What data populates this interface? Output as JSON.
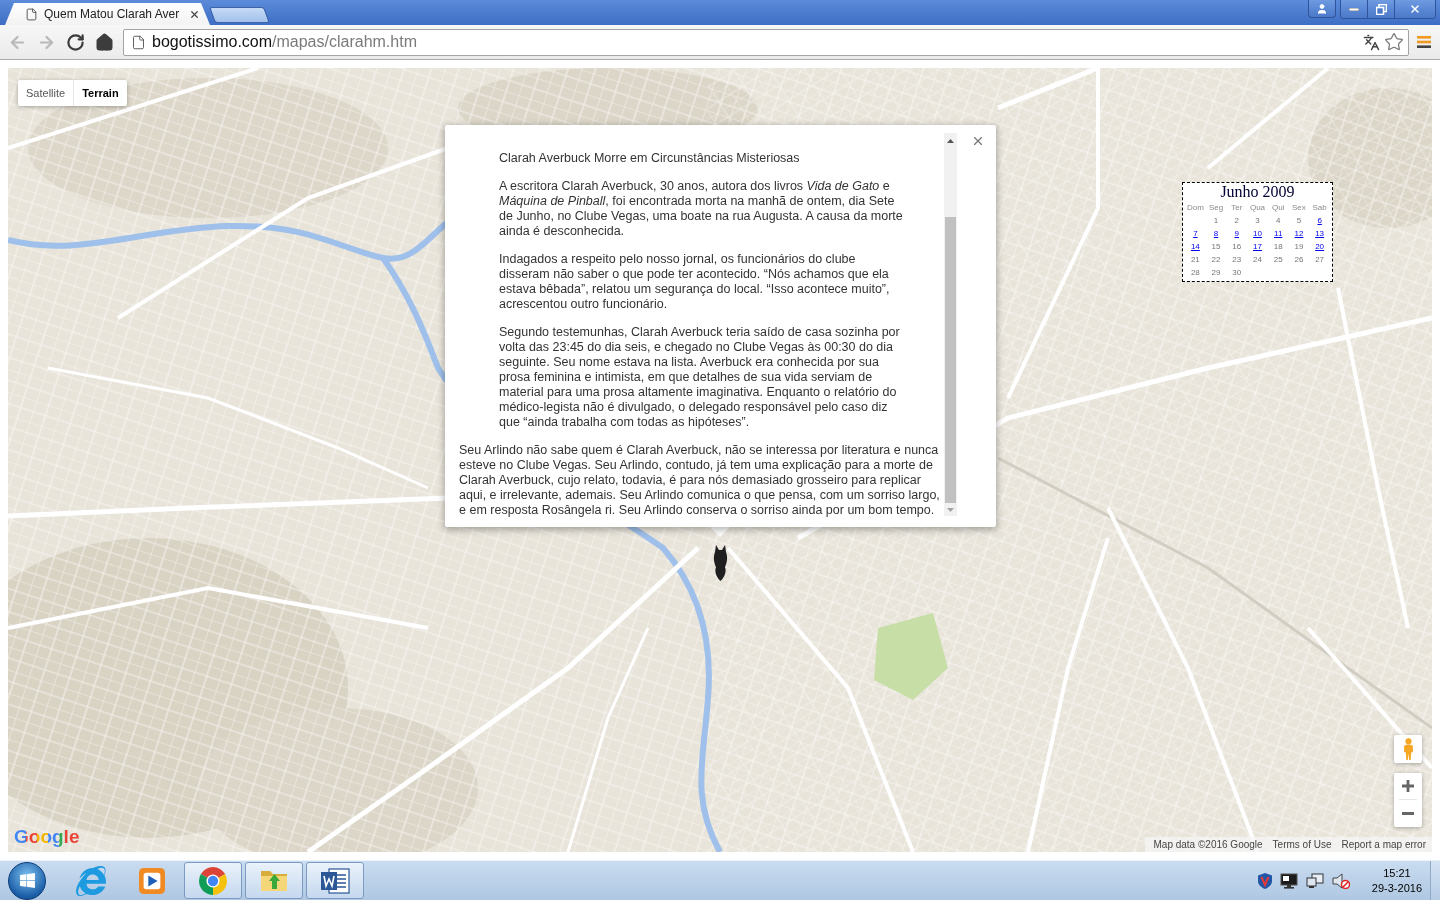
{
  "browser": {
    "tabs": [
      {
        "title": "Quem Matou Clarah Aver",
        "selected": true
      }
    ],
    "nav_buttons": [
      {
        "kind": "back",
        "disabled": true
      },
      {
        "kind": "forward",
        "disabled": true
      },
      {
        "kind": "reload",
        "disabled": false
      },
      {
        "kind": "home",
        "disabled": false
      }
    ],
    "address": {
      "host": "bogotissimo.com",
      "path": "/mapas/clarahm.htm"
    },
    "menu": {
      "update_available": true
    }
  },
  "map": {
    "map_types": [
      {
        "label": "Satellite",
        "selected": false
      },
      {
        "label": "Terrain",
        "selected": true
      }
    ],
    "info_window": {
      "quote": [
        "Clarah Averbuck Morre em Circunstâncias Misteriosas",
        "A escritora Clarah Averbuck, 30 anos, autora dos livros *Vida de Gato* e *Máquina de Pinball*, foi encontrada morta na manhã de ontem, dia Sete de Junho, no Clube Vegas, uma boate na rua Augusta. A causa da morte ainda é desconhecida.",
        "Indagados a respeito pelo nosso jornal, os funcionários do clube disseram não saber o que pode ter acontecido. “Nós achamos que ela estava bêbada”, relatou um segurança do local. “Isso acontece muito”, acrescentou outro funcionário.",
        "Segundo testemunhas, Clarah Averbuck teria saído de casa sozinha por volta das 23:45 do dia seis, e chegado no Clube Vegas às 00:30 do dia seguinte. Seu nome estava na lista. Averbuck era conhecida por sua prosa feminina e intimista, em que detalhes de sua vida serviam de material para uma prosa altamente imaginativa. Enquanto o relatório do médico-legista não é divulgado, o delegado responsável pelo caso diz que “ainda trabalha com todas as hipóteses”."
      ],
      "paragraph": "Seu Arlindo não sabe quem é Clarah Averbuck, não se interessa por literatura e nunca esteve no Clube Vegas. Seu Arlindo, contudo, já tem uma explicação para a morte de Clarah Averbuck, cujo relato, todavia, é para nós demasiado grosseiro para replicar aqui, e irrelevante, ademais. Seu Arlindo comunica o que pensa, com um sorriso largo, e em resposta Rosângela ri. Seu Arlindo conserva o sorriso ainda por um bom tempo."
    },
    "calendar": {
      "title": "Junho 2009",
      "weekdays": [
        "Dom",
        "Seg",
        "Ter",
        "Qua",
        "Qui",
        "Sex",
        "Sab"
      ],
      "weeks": [
        {
          "days": [
            {
              "label": "1",
              "linked": false
            },
            {
              "label": "2",
              "linked": false
            },
            {
              "label": "3",
              "linked": false
            },
            {
              "label": "4",
              "linked": false
            },
            {
              "label": "5",
              "linked": false
            },
            {
              "label": "6",
              "linked": true
            }
          ]
        },
        {
          "days": [
            {
              "label": "7",
              "linked": true
            },
            {
              "label": "8",
              "linked": true
            },
            {
              "label": "9",
              "linked": true
            },
            {
              "label": "10",
              "linked": true
            },
            {
              "label": "11",
              "linked": true
            },
            {
              "label": "12",
              "linked": true
            },
            {
              "label": "13",
              "linked": true
            }
          ]
        },
        {
          "days": [
            {
              "label": "14",
              "linked": true
            },
            {
              "label": "15",
              "linked": false
            },
            {
              "label": "16",
              "linked": false
            },
            {
              "label": "17",
              "linked": true
            },
            {
              "label": "18",
              "linked": false
            },
            {
              "label": "19",
              "linked": false
            },
            {
              "label": "20",
              "linked": true
            }
          ]
        },
        {
          "days": [
            {
              "label": "21",
              "linked": false
            },
            {
              "label": "22",
              "linked": false
            },
            {
              "label": "23",
              "linked": false
            },
            {
              "label": "24",
              "linked": false
            },
            {
              "label": "25",
              "linked": false
            },
            {
              "label": "26",
              "linked": false
            },
            {
              "label": "27",
              "linked": false
            }
          ]
        },
        {
          "days": [
            {
              "label": "28",
              "linked": false
            },
            {
              "label": "29",
              "linked": false
            },
            {
              "label": "30",
              "linked": false
            }
          ]
        }
      ]
    },
    "logo": "Google",
    "attribution": {
      "data": "Map data ©2016 Google",
      "links": [
        "Terms of Use",
        "Report a map error"
      ]
    }
  },
  "taskbar": {
    "apps": [
      {
        "kind": "letter-e",
        "running": false
      },
      {
        "kind": "media-player",
        "running": false
      },
      {
        "kind": "browser",
        "running": true
      },
      {
        "kind": "folder",
        "running": true
      },
      {
        "kind": "document",
        "running": true
      }
    ],
    "volume": {
      "muted": true
    },
    "clock": {
      "time": "15:21",
      "date": "29-3-2016"
    }
  }
}
